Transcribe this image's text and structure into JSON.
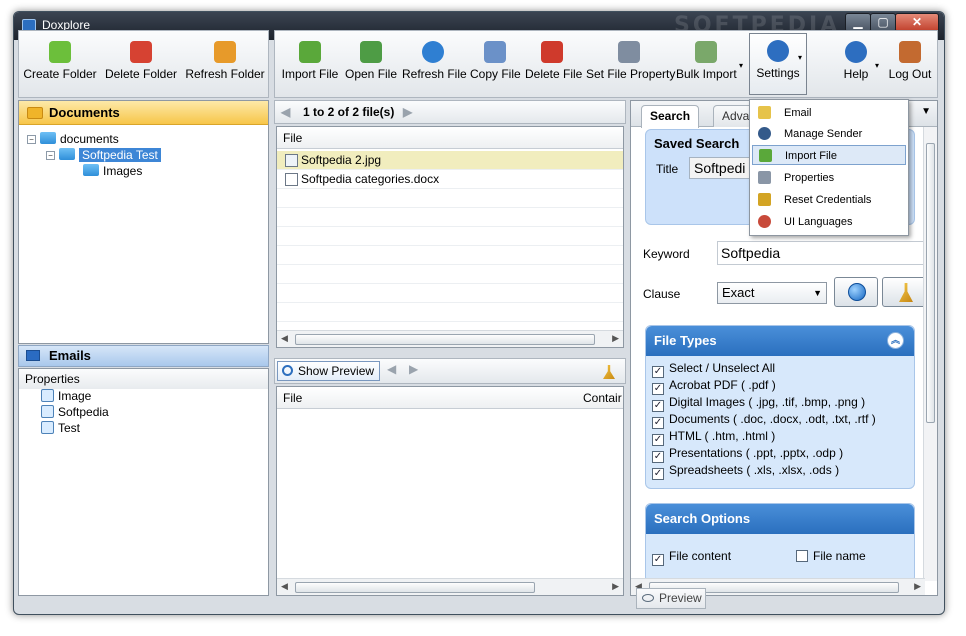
{
  "window": {
    "title": "Doxplore",
    "watermark": "SOFTPEDIA",
    "min": "▁",
    "max": "▢",
    "close": "✕"
  },
  "left_toolbar": [
    {
      "label": "Create Folder",
      "icon": "create-folder-icon",
      "color": "#6cbf3b"
    },
    {
      "label": "Delete Folder",
      "icon": "delete-folder-icon",
      "color": "#d64232"
    },
    {
      "label": "Refresh Folder",
      "icon": "refresh-folder-icon",
      "color": "#e79a2a"
    }
  ],
  "main_toolbar": [
    {
      "label": "Import File",
      "icon": "import-file-icon",
      "color": "#5aa83a"
    },
    {
      "label": "Open File",
      "icon": "open-file-icon",
      "color": "#4e9c45"
    },
    {
      "label": "Refresh File",
      "icon": "refresh-file-icon",
      "color": "#2f7fd2"
    },
    {
      "label": "Copy File",
      "icon": "copy-file-icon",
      "color": "#6b91c8"
    },
    {
      "label": "Delete File",
      "icon": "delete-file-icon",
      "color": "#cf3a2c"
    },
    {
      "label": "Set File Property",
      "icon": "set-file-property-icon",
      "color": "#7f8da0"
    },
    {
      "label": "Bulk Import",
      "icon": "bulk-import-icon",
      "color": "#7aa86a"
    },
    {
      "label": "Settings",
      "icon": "settings-gear-icon",
      "color": "#2d6ec0"
    },
    {
      "label": "Help",
      "icon": "help-icon",
      "color": "#2d6ec0"
    },
    {
      "label": "Log Out",
      "icon": "log-out-icon",
      "color": "#c36a30"
    }
  ],
  "caret": "▾",
  "folders": {
    "header": "Documents",
    "tree": [
      {
        "label": "documents",
        "toggle": "−"
      },
      {
        "label": "Softpedia Test",
        "toggle": "−"
      },
      {
        "label": "Images"
      }
    ]
  },
  "emails": {
    "label": "Emails"
  },
  "properties": {
    "header": "Properties",
    "items": [
      "Image",
      "Softpedia",
      "Test"
    ]
  },
  "files": {
    "nav_prev": "◀",
    "nav_next": "▶",
    "count_text": "1 to 2 of 2 file(s)",
    "column": "File",
    "rows": [
      "Softpedia 2.jpg",
      "Softpedia categories.docx"
    ]
  },
  "preview_toolbar": {
    "show_preview": "Show Preview"
  },
  "content_table": {
    "columns": [
      "File",
      "Contair"
    ]
  },
  "search": {
    "tabs": [
      "Search",
      "Adva"
    ],
    "tab_menu": "▼",
    "saved_search": {
      "title": "Saved Search",
      "field_label": "Title",
      "value": "Softpedi"
    },
    "keyword_label": "Keyword",
    "keyword_value": "Softpedia",
    "clause_label": "Clause",
    "clause_value": "Exact",
    "file_types": {
      "header": "File Types",
      "collapse": "︽",
      "items": [
        "Select / Unselect  All",
        "Acrobat PDF ( .pdf )",
        "Digital Images ( .jpg, .tif, .bmp, .png )",
        "Documents ( .doc, .docx, .odt, .txt, .rtf )",
        "HTML ( .htm, .html )",
        "Presentations ( .ppt, .pptx, .odp )",
        "Spreadsheets ( .xls, .xlsx, .ods )"
      ]
    },
    "search_options": {
      "header": "Search Options",
      "items": [
        {
          "label": "File content",
          "checked": true
        },
        {
          "label": "File name",
          "checked": false
        }
      ]
    },
    "check_mark": "✓"
  },
  "preview_tab": {
    "label": "Preview"
  },
  "settings_menu": [
    {
      "label": "Email",
      "icon": "email-icon",
      "color": "#e6c34a"
    },
    {
      "label": "Manage Sender",
      "icon": "manage-sender-icon",
      "color": "#345a8a"
    },
    {
      "label": "Import File",
      "icon": "import-file-menu-icon",
      "color": "#5aa83a"
    },
    {
      "label": "Properties",
      "icon": "properties-icon",
      "color": "#8a96a6"
    },
    {
      "label": "Reset Credentials",
      "icon": "reset-credentials-icon",
      "color": "#d3a424"
    },
    {
      "label": "UI Languages",
      "icon": "ui-languages-icon",
      "color": "#c84a3a"
    }
  ]
}
